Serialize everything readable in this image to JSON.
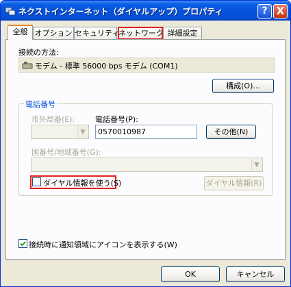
{
  "window": {
    "title": "ネクストインターネット（ダイヤルアップ）プロパティ",
    "help_label": "?",
    "close_label": "X"
  },
  "tabs": [
    {
      "label": "全般"
    },
    {
      "label": "オプション"
    },
    {
      "label": "セキュリティ"
    },
    {
      "label": "ネットワーク"
    },
    {
      "label": "詳細設定"
    }
  ],
  "connection": {
    "method_label": "接続の方法:",
    "modem_value": "モデム - 標準 56000 bps モデム (COM1)",
    "configure_button": "構成(O)..."
  },
  "phone": {
    "group_title": "電話番号",
    "area_code_label": "市外局番(E):",
    "phone_number_label": "電話番号(P):",
    "phone_number_value": "0570010987",
    "others_button": "その他(N)",
    "country_label": "国番号/地域番号(G):",
    "use_dialing_rules_label": "ダイヤル情報を使う(S)",
    "use_dialing_rules_checked": false,
    "dialing_rules_button": "ダイヤル情報(R)"
  },
  "notify": {
    "label": "接続時に通知領域にアイコンを表示する(W)",
    "checked": true
  },
  "footer": {
    "ok": "OK",
    "cancel": "キャンセル"
  }
}
